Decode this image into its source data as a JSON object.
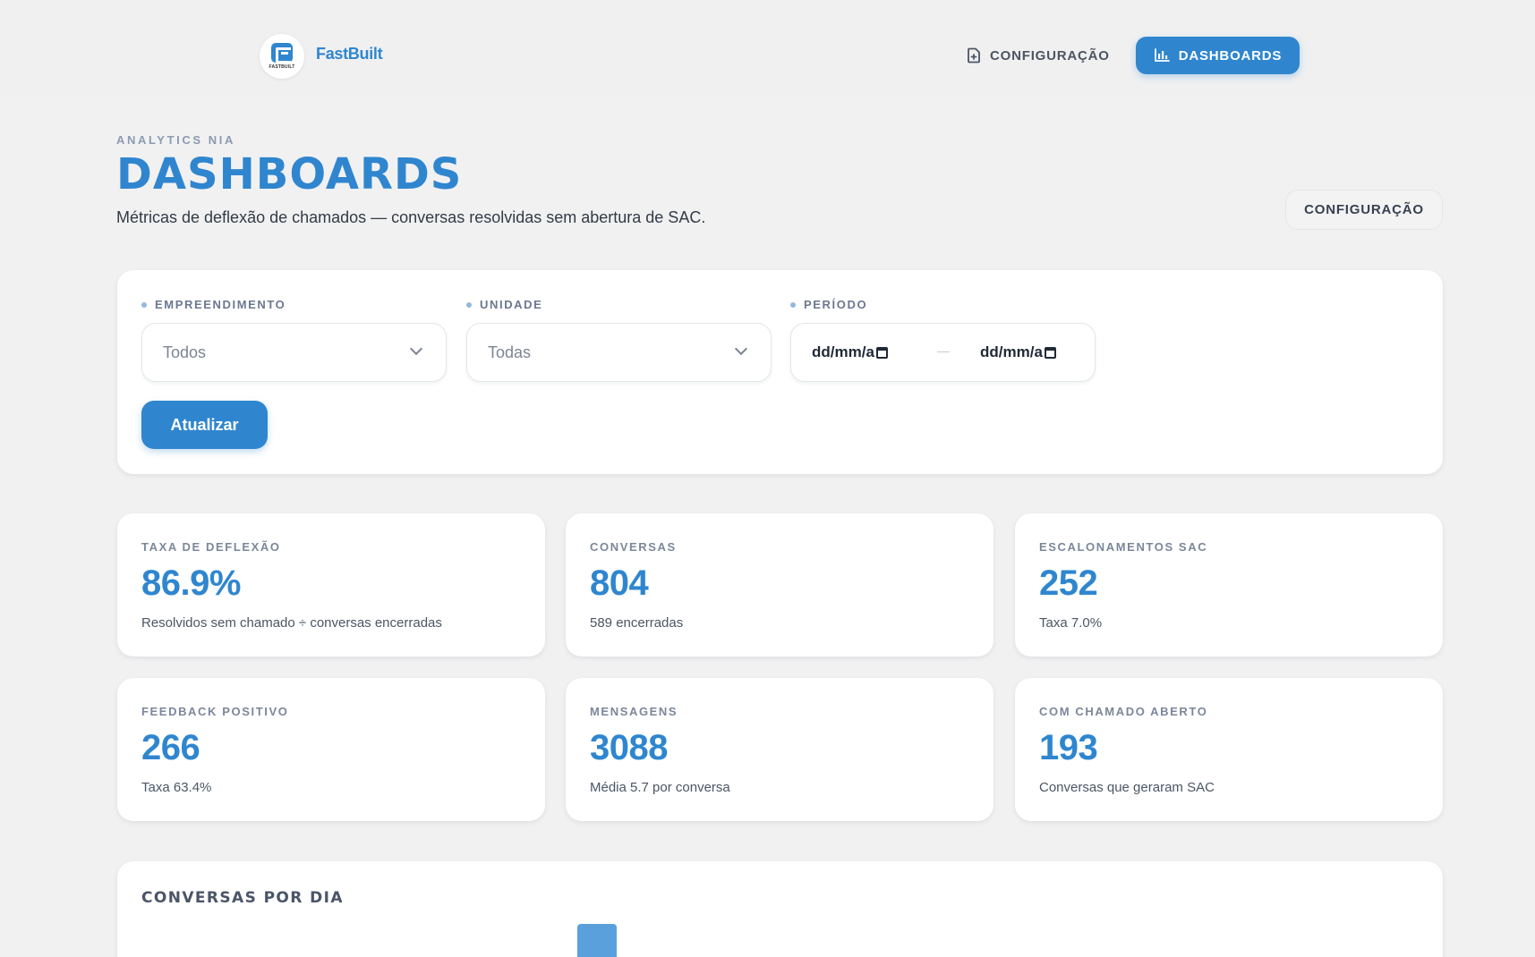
{
  "header": {
    "logo_tiny_text": "FASTBUILT",
    "brand": "FastBuilt",
    "nav": {
      "config_label": "CONFIGURAÇÃO",
      "dashboards_label": "DASHBOARDS",
      "active": "dashboards"
    }
  },
  "page": {
    "eyebrow": "ANALYTICS NIA",
    "title": "DASHBOARDS",
    "subtitle": "Métricas de deflexão de chamados — conversas resolvidas sem abertura de SAC.",
    "config_button": "CONFIGURAÇÃO"
  },
  "filters": {
    "empreendimento": {
      "label": "EMPREENDIMENTO",
      "value": "Todos"
    },
    "unidade": {
      "label": "UNIDADE",
      "value": "Todas"
    },
    "periodo": {
      "label": "PERÍODO",
      "start_placeholder": "dd/mm/a",
      "end_placeholder": "dd/mm/a"
    },
    "refresh_button": "Atualizar"
  },
  "kpis": [
    {
      "label": "TAXA DE DEFLEXÃO",
      "value": "86.9%",
      "desc": "Resolvidos sem chamado ÷ conversas encerradas"
    },
    {
      "label": "CONVERSAS",
      "value": "804",
      "desc": "589 encerradas"
    },
    {
      "label": "ESCALONAMENTOS SAC",
      "value": "252",
      "desc": "Taxa 7.0%"
    },
    {
      "label": "FEEDBACK POSITIVO",
      "value": "266",
      "desc": "Taxa 63.4%"
    },
    {
      "label": "MENSAGENS",
      "value": "3088",
      "desc": "Média 5.7 por conversa"
    },
    {
      "label": "COM CHAMADO ABERTO",
      "value": "193",
      "desc": "Conversas que geraram SAC"
    }
  ],
  "chart": {
    "title": "CONVERSAS POR DIA",
    "bar_color": "#5aa0dc"
  },
  "colors": {
    "accent": "#2f86cf",
    "background": "#f1f1f2",
    "card": "#ffffff"
  }
}
